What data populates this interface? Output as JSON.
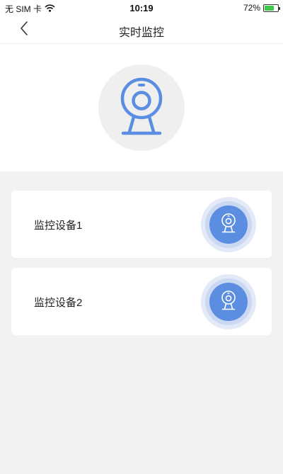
{
  "status_bar": {
    "carrier": "无 SIM 卡",
    "time": "10:19",
    "battery": "72%",
    "battery_level": 0.72
  },
  "header": {
    "title": "实时监控",
    "back_icon": "chevron-left-icon"
  },
  "hero": {
    "icon": "webcam-icon"
  },
  "devices": [
    {
      "name": "监控设备1",
      "icon": "webcam-icon"
    },
    {
      "name": "监控设备2",
      "icon": "webcam-icon"
    }
  ],
  "colors": {
    "accent": "#5b8de0",
    "background": "#f2f2f2",
    "card": "#ffffff",
    "battery": "#3cc84a"
  }
}
